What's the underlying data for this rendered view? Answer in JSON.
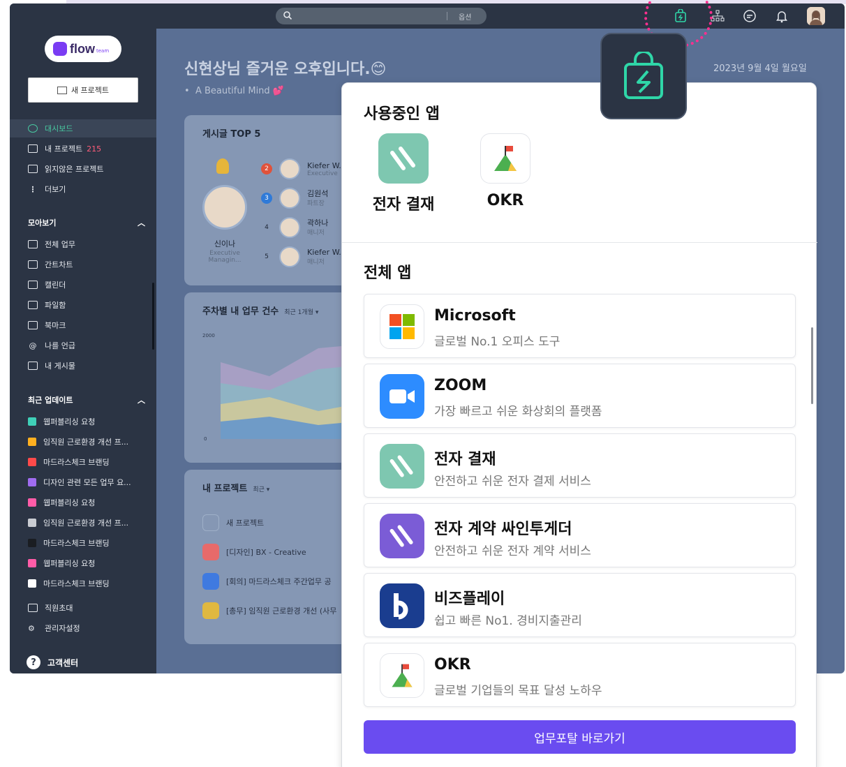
{
  "topbar": {
    "search_placeholder": "",
    "search_option": "옵션"
  },
  "sidebar": {
    "logo_text": "flow",
    "logo_sub": "team",
    "new_project": "새 프로젝트",
    "nav": [
      {
        "label": "대시보드",
        "icon": "dashboard-icon",
        "active": true
      },
      {
        "label": "내 프로젝트",
        "count": "215",
        "icon": "folder-icon"
      },
      {
        "label": "읽지않은 프로젝트",
        "icon": "mail-icon"
      },
      {
        "label": "더보기",
        "icon": "more-vertical-icon"
      }
    ],
    "section_collect": "모아보기",
    "collect_items": [
      {
        "label": "전체 업무",
        "icon": "list-icon"
      },
      {
        "label": "간트차트",
        "icon": "gantt-icon"
      },
      {
        "label": "캘린더",
        "icon": "calendar-icon"
      },
      {
        "label": "파일함",
        "icon": "file-box-icon"
      },
      {
        "label": "북마크",
        "icon": "bookmark-icon"
      },
      {
        "label": "나를 언급",
        "icon": "mention-icon"
      },
      {
        "label": "내 게시물",
        "icon": "my-posts-icon"
      }
    ],
    "section_recent": "최근 업데이트",
    "recent_items": [
      {
        "label": "웹퍼블리싱 요청",
        "color": "#3fd0b8"
      },
      {
        "label": "임직원 근로환경 개선 프...",
        "color": "#ffb020"
      },
      {
        "label": "마드라스체크 브랜딩",
        "color": "#ff4a4a"
      },
      {
        "label": "디자인 관련 모든 업무 요...",
        "color": "#a06cf0"
      },
      {
        "label": "웹퍼블리싱 요청",
        "color": "#ff5ca8"
      },
      {
        "label": "임직원 근로환경 개선 프...",
        "color": "#c9ccd2"
      },
      {
        "label": "마드라스체크 브랜딩",
        "color": "#1a1d22"
      },
      {
        "label": "웹퍼블리싱 요청",
        "color": "#ff5ca8"
      },
      {
        "label": "마드라스체크 브랜딩",
        "color": "#ffffff"
      }
    ],
    "bottom_items": [
      {
        "label": "직원초대",
        "icon": "invite-icon"
      },
      {
        "label": "관리자설정",
        "icon": "admin-settings-icon"
      }
    ],
    "help": "고객센터"
  },
  "dashboard": {
    "greeting": "신현상님 즐거운 오후입니다.😊",
    "motto": "A Beautiful Mind 💕",
    "date": "2023년 9월 4일 월요일",
    "top5_title": "게시글 TOP 5",
    "top1_name": "신이나",
    "top1_role": "Executive Managin...",
    "ranks": [
      {
        "rank": "2",
        "name": "Kiefer W...",
        "role": "Executive"
      },
      {
        "rank": "3",
        "name": "김원석",
        "role": "파트장"
      },
      {
        "rank": "4",
        "name": "곽하나",
        "role": "매니저"
      },
      {
        "rank": "5",
        "name": "Kiefer W...",
        "role": "매니저"
      }
    ],
    "weekly_title": "주차별 내 업무 건수",
    "weekly_sub": "최근 1개월 ▾",
    "chart_y_top": "2000",
    "chart_y_zero": "0",
    "projects_title": "내 프로젝트",
    "projects_sub": "최근 ▾",
    "projects": [
      {
        "label": "새 프로젝트",
        "color": "#9fb0c8"
      },
      {
        "label": "[디자인] BX - Creative",
        "color": "#e86a6a"
      },
      {
        "label": "[회의] 마드라스체크 주간업무 공",
        "color": "#3f7ae0"
      },
      {
        "label": "[총무] 임직원 근로환경 개선 (사무",
        "color": "#e0b840"
      }
    ]
  },
  "app_panel": {
    "using_title": "사용중인 앱",
    "using_apps": [
      {
        "label": "전자 결재",
        "icon": "e-approval-icon"
      },
      {
        "label": "OKR",
        "icon": "okr-flag-icon"
      }
    ],
    "all_title": "전체 앱",
    "apps": [
      {
        "name": "Microsoft",
        "desc": "글로벌 No.1 오피스 도구",
        "icon": "microsoft-icon"
      },
      {
        "name": "ZOOM",
        "desc": "가장 빠르고 쉬운 화상회의 플랫폼",
        "icon": "zoom-icon"
      },
      {
        "name": "전자 결재",
        "desc": "안전하고 쉬운 전자 결제 서비스",
        "icon": "e-approval-icon"
      },
      {
        "name": "전자 계약 싸인투게더",
        "desc": "안전하고 쉬운 전자 계약 서비스",
        "icon": "e-contract-icon"
      },
      {
        "name": "비즈플레이",
        "desc": "쉽고 빠른 No1. 경비지출관리",
        "icon": "bizplay-icon"
      },
      {
        "name": "OKR",
        "desc": "글로벌 기업들의 목표 달성 노하우",
        "icon": "okr-flag-icon"
      }
    ],
    "portal_button": "업무포탈 바로가기"
  },
  "colors": {
    "accent": "#6a4cf0",
    "sidebar_bg": "#2b3444",
    "active_green": "#48c8a0",
    "store_green": "#2fd6a8",
    "highlight_dots": "#ff2f8f"
  }
}
